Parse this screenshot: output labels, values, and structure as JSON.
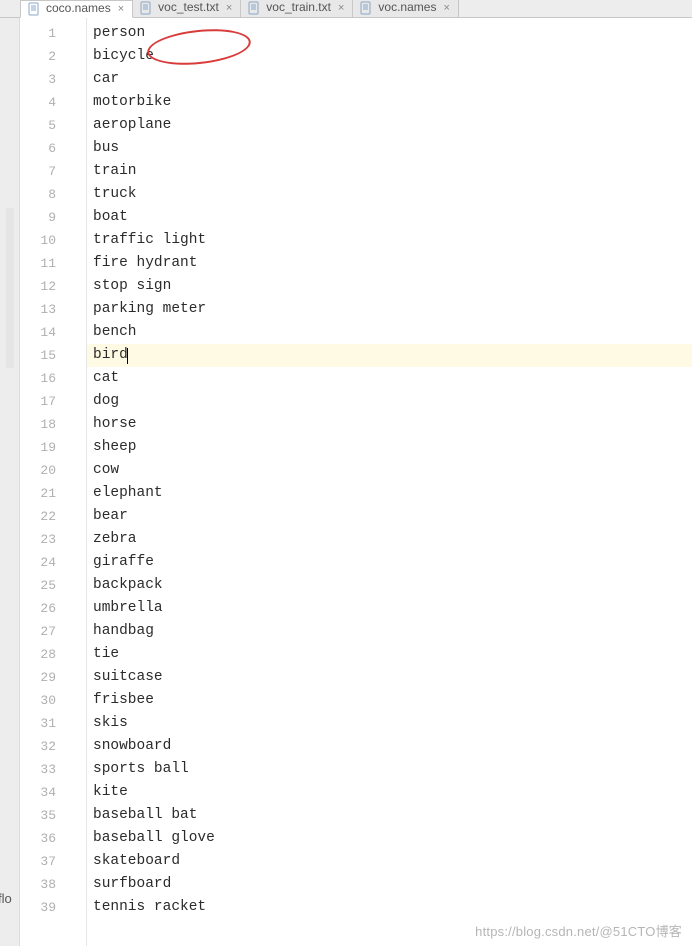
{
  "tabs": [
    {
      "label": "coco.names",
      "active": true
    },
    {
      "label": "voc_test.txt",
      "active": false
    },
    {
      "label": "voc_train.txt",
      "active": false
    },
    {
      "label": "voc.names",
      "active": false
    }
  ],
  "current_line_index": 14,
  "lines": [
    "person",
    "bicycle",
    "car",
    "motorbike",
    "aeroplane",
    "bus",
    "train",
    "truck",
    "boat",
    "traffic light",
    "fire hydrant",
    "stop sign",
    "parking meter",
    "bench",
    "bird",
    "cat",
    "dog",
    "horse",
    "sheep",
    "cow",
    "elephant",
    "bear",
    "zebra",
    "giraffe",
    "backpack",
    "umbrella",
    "handbag",
    "tie",
    "suitcase",
    "frisbee",
    "skis",
    "snowboard",
    "sports ball",
    "kite",
    "baseball bat",
    "baseball glove",
    "skateboard",
    "surfboard",
    "tennis racket"
  ],
  "watermark": "https://blog.csdn.net/@51CTO博客",
  "side_label": "flo",
  "icons": {
    "close": "×"
  }
}
